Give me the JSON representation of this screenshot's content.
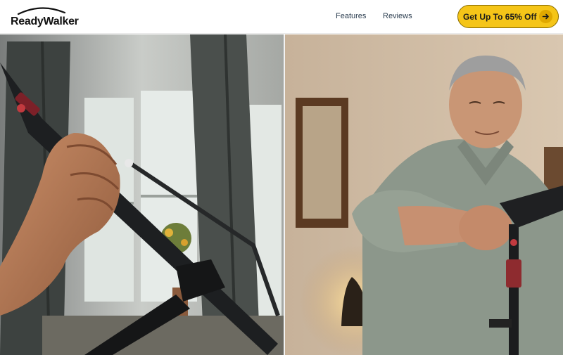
{
  "brand": {
    "name": "ReadyWalker",
    "logo_icon": "swoosh-arc"
  },
  "nav": {
    "links": [
      {
        "label": "Features"
      },
      {
        "label": "Reviews"
      }
    ]
  },
  "cta": {
    "label": "Get Up To 65% Off",
    "icon": "arrow-right-icon",
    "color": "#f5c518"
  },
  "hero": {
    "left_image": "hand-gripping-folding-cane",
    "right_image": "senior-man-holding-cane"
  }
}
